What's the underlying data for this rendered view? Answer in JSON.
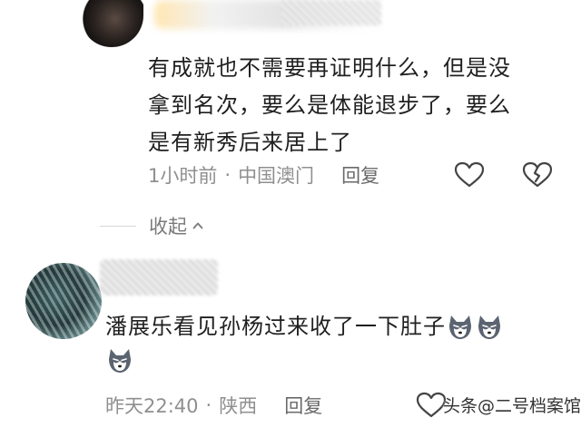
{
  "comments": [
    {
      "text_lines": [
        "有成就也不需要再证明什么，但是没",
        "拿到名次，要么是体能退步了，要么",
        "是有新秀后来居上了"
      ],
      "time": "1小时前",
      "separator": "·",
      "location": "中国澳门",
      "reply_label": "回复",
      "icons": [
        "heart-outline-icon",
        "broken-heart-outline-icon"
      ]
    },
    {
      "text": "潘展乐看见孙杨过来收了一下肚子",
      "emojis": [
        "husky-emoji",
        "husky-emoji",
        "husky-emoji"
      ],
      "time": "昨天22:40",
      "separator": "·",
      "location": "陕西",
      "reply_label": "回复",
      "icons": [
        "heart-outline-icon"
      ]
    }
  ],
  "collapse_label": "收起",
  "watermark": "头条@二号档案馆",
  "colors": {
    "text": "#1f1f1f",
    "meta": "#8f8f8f",
    "background": "#ffffff"
  }
}
